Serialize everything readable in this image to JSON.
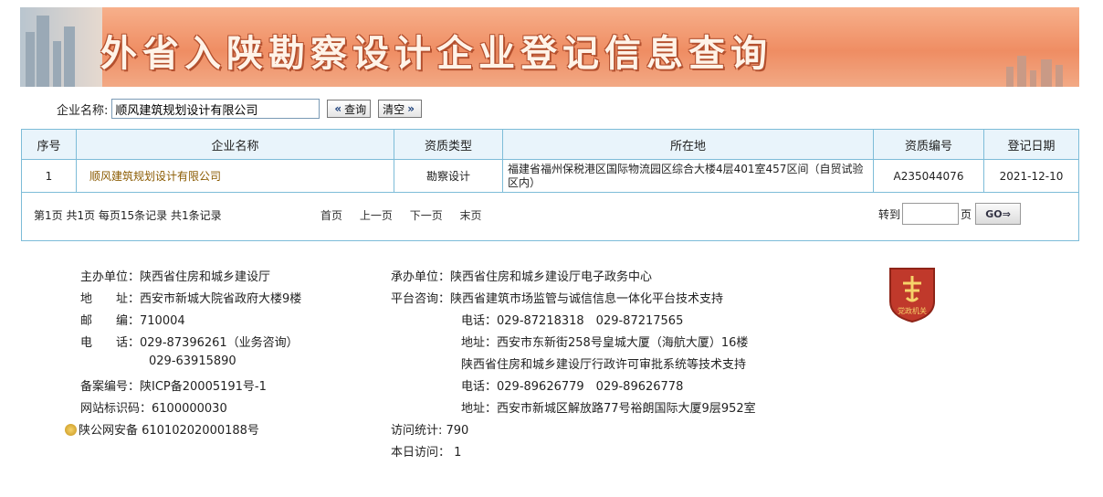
{
  "banner": {
    "title": "外省入陕勘察设计企业登记信息查询"
  },
  "search": {
    "label": "企业名称:",
    "value": "顺风建筑规划设计有限公司",
    "query_button": "查询",
    "clear_button": "清空"
  },
  "table": {
    "headers": [
      "序号",
      "企业名称",
      "资质类型",
      "所在地",
      "资质编号",
      "登记日期"
    ],
    "rows": [
      {
        "index": "1",
        "name": "顺风建筑规划设计有限公司",
        "type": "勘察设计",
        "location": "福建省福州保税港区国际物流园区综合大楼4层401室457区间（自贸试验区内）",
        "cert_no": "A235044076",
        "date": "2021-12-10"
      }
    ]
  },
  "pager": {
    "info": "第1页 共1页 每页15条记录 共1条记录",
    "first": "首页",
    "prev": "上一页",
    "next": "下一页",
    "last": "末页",
    "jump_label": "转到",
    "page_unit": "页",
    "go_label": "GO"
  },
  "footer": {
    "host": "主办单位：陕西省住房和城乡建设厅",
    "address": "地　　址：西安市新城大院省政府大楼9楼",
    "postcode": "邮　　编：710004",
    "phone1": "电　　话：029-87396261（业务咨询）",
    "phone2": "029-63915890",
    "icp": "备案编号：陕ICP备20005191号-1",
    "site_id": "网站标识码：6100000030",
    "police": "陕公网安备 61010202000188号",
    "organizer": "承办单位：陕西省住房和城乡建设厅电子政务中心",
    "platform": "平台咨询：陕西省建筑市场监管与诚信信息一体化平台技术支持",
    "platform_phone": "电话：029-87218318　029-87217565",
    "platform_addr": "地址：西安市东新街258号皇城大厦（海航大厦）16楼",
    "approval": "陕西省住房和城乡建设厅行政许可审批系统等技术支持",
    "approval_phone": "电话：029-89626779　029-89626778",
    "approval_addr": "地址：西安市新城区解放路77号裕朗国际大厦9层952室",
    "visits": "访问统计: 790",
    "today": "本日访问： 1",
    "emblem_text": "党政机关"
  }
}
